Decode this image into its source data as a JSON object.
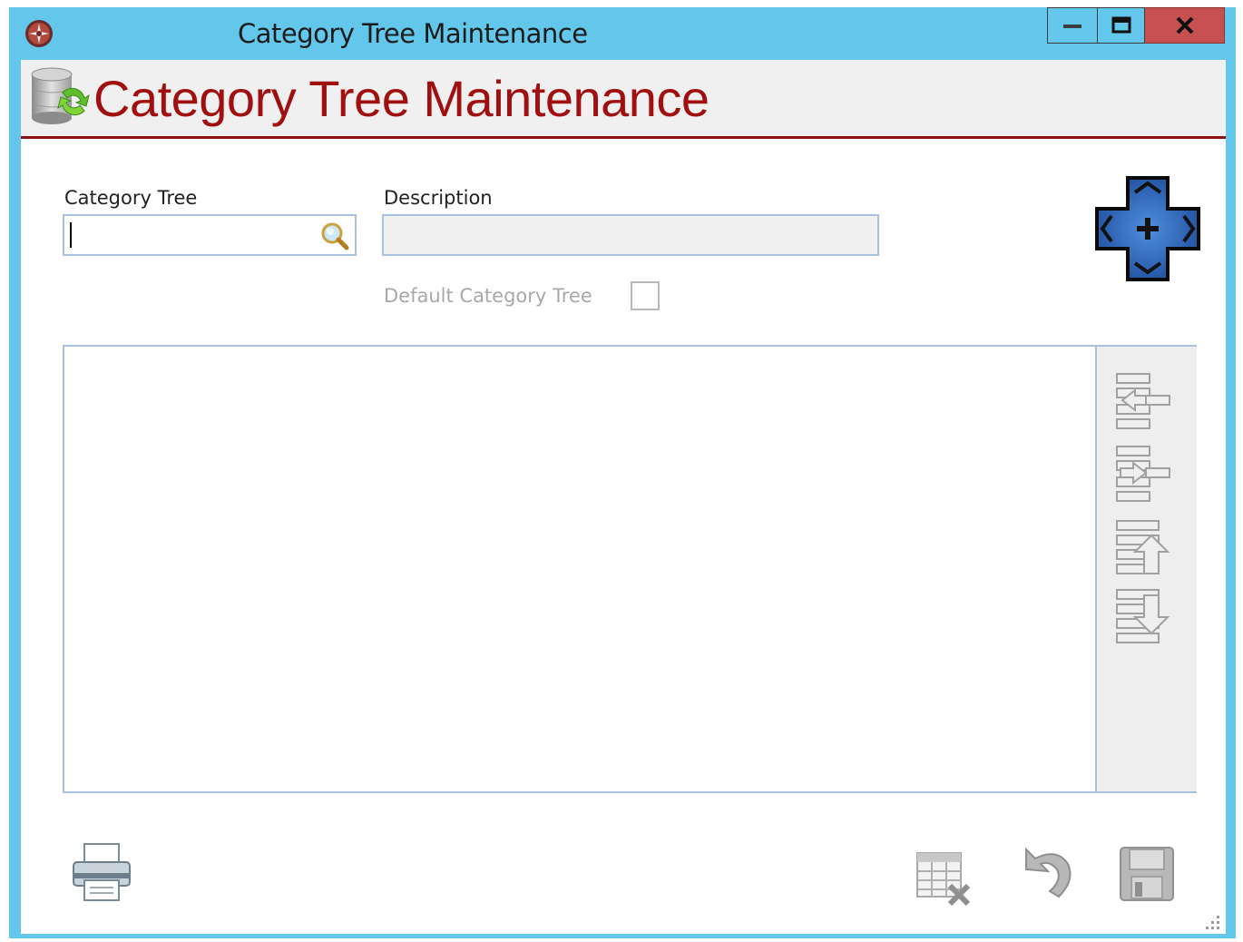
{
  "window": {
    "title": "Category Tree Maintenance",
    "buttons": {
      "minimize": "minimize-icon",
      "maximize": "maximize-icon",
      "close": "close-icon"
    }
  },
  "header": {
    "title": "Category Tree Maintenance",
    "icon": "database-refresh-icon",
    "title_color": "#a01010",
    "rule_color": "#8b1010"
  },
  "form": {
    "category_tree": {
      "label": "Category Tree",
      "value": ""
    },
    "description": {
      "label": "Description",
      "value": ""
    },
    "default_category_tree": {
      "label": "Default Category Tree",
      "checked": false
    }
  },
  "tree_tools": [
    "move-left-icon",
    "move-right-icon",
    "move-up-icon",
    "move-down-icon"
  ],
  "bottom_toolbar": [
    "print-icon",
    "delete-icon",
    "undo-icon",
    "save-icon"
  ],
  "colors": {
    "titlebar": "#62c7ea",
    "close_button": "#c75050",
    "border": "#a8c0dc"
  }
}
